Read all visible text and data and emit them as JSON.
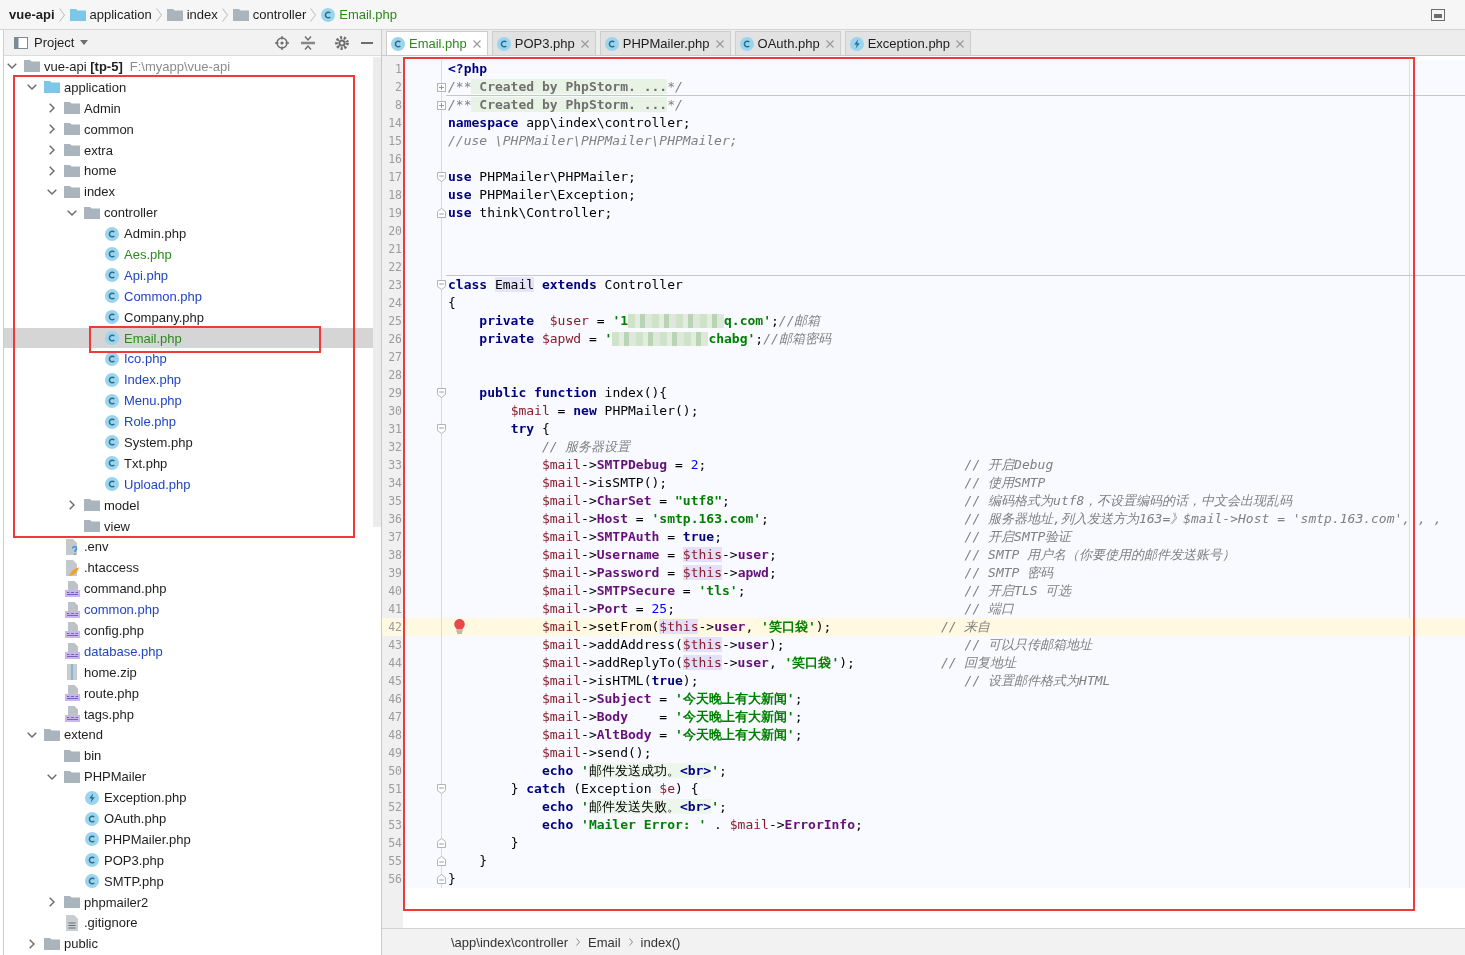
{
  "nav_bar": {
    "items": [
      {
        "label": "vue-api",
        "kind": "project",
        "added": false,
        "modified": false
      },
      {
        "label": "application",
        "kind": "source_folder",
        "added": false,
        "modified": false
      },
      {
        "label": "index",
        "kind": "folder",
        "added": false,
        "modified": false
      },
      {
        "label": "controller",
        "kind": "folder",
        "added": false,
        "modified": false
      },
      {
        "label": "Email.php",
        "kind": "class",
        "added": true,
        "modified": false
      }
    ]
  },
  "project_panel": {
    "title": "Project",
    "tree": [
      {
        "label": "vue-api **[tp-5]**",
        "path": "F:\\myapp\\vue-api",
        "kind": "folder",
        "expanded": true,
        "selected": false,
        "added": false,
        "modified": false,
        "children": [
          {
            "label": "application",
            "kind": "source_folder",
            "expanded": true,
            "selected": false,
            "added": false,
            "modified": false,
            "children": [
              {
                "label": "Admin",
                "kind": "folder",
                "expanded": false,
                "selected": false,
                "added": false,
                "modified": false
              },
              {
                "label": "common",
                "kind": "folder",
                "expanded": false,
                "selected": false,
                "added": false,
                "modified": false
              },
              {
                "label": "extra",
                "kind": "folder",
                "expanded": false,
                "selected": false,
                "added": false,
                "modified": false
              },
              {
                "label": "home",
                "kind": "folder",
                "expanded": false,
                "selected": false,
                "added": false,
                "modified": false
              },
              {
                "label": "index",
                "kind": "folder",
                "expanded": true,
                "selected": false,
                "added": false,
                "modified": false,
                "children": [
                  {
                    "label": "controller",
                    "kind": "folder",
                    "expanded": true,
                    "selected": false,
                    "added": false,
                    "modified": false,
                    "children": [
                      {
                        "label": "Admin.php",
                        "kind": "class",
                        "selected": false,
                        "added": false,
                        "modified": false
                      },
                      {
                        "label": "Aes.php",
                        "kind": "class",
                        "selected": false,
                        "added": true,
                        "modified": false
                      },
                      {
                        "label": "Api.php",
                        "kind": "class",
                        "selected": false,
                        "added": false,
                        "modified": true
                      },
                      {
                        "label": "Common.php",
                        "kind": "class",
                        "selected": false,
                        "added": false,
                        "modified": true
                      },
                      {
                        "label": "Company.php",
                        "kind": "class",
                        "selected": false,
                        "added": false,
                        "modified": false
                      },
                      {
                        "label": "Email.php",
                        "kind": "class",
                        "selected": true,
                        "added": true,
                        "modified": false
                      },
                      {
                        "label": "Ico.php",
                        "kind": "class",
                        "selected": false,
                        "added": false,
                        "modified": true
                      },
                      {
                        "label": "Index.php",
                        "kind": "class",
                        "selected": false,
                        "added": false,
                        "modified": true
                      },
                      {
                        "label": "Menu.php",
                        "kind": "class",
                        "selected": false,
                        "added": false,
                        "modified": true
                      },
                      {
                        "label": "Role.php",
                        "kind": "class",
                        "selected": false,
                        "added": false,
                        "modified": true
                      },
                      {
                        "label": "System.php",
                        "kind": "class",
                        "selected": false,
                        "added": false,
                        "modified": false
                      },
                      {
                        "label": "Txt.php",
                        "kind": "class",
                        "selected": false,
                        "added": false,
                        "modified": false
                      },
                      {
                        "label": "Upload.php",
                        "kind": "class",
                        "selected": false,
                        "added": false,
                        "modified": true
                      }
                    ]
                  },
                  {
                    "label": "model",
                    "kind": "folder",
                    "expanded": false,
                    "selected": false,
                    "added": false,
                    "modified": false
                  },
                  {
                    "label": "view",
                    "kind": "folder",
                    "selected": false,
                    "added": false,
                    "modified": false
                  }
                ]
              },
              {
                "label": ".env",
                "kind": "env",
                "selected": false,
                "added": false,
                "modified": false
              },
              {
                "label": ".htaccess",
                "kind": "htaccess",
                "selected": false,
                "added": false,
                "modified": false
              },
              {
                "label": "command.php",
                "kind": "php",
                "selected": false,
                "added": false,
                "modified": false
              },
              {
                "label": "common.php",
                "kind": "php",
                "selected": false,
                "added": false,
                "modified": true
              },
              {
                "label": "config.php",
                "kind": "php",
                "selected": false,
                "added": false,
                "modified": false
              },
              {
                "label": "database.php",
                "kind": "php",
                "selected": false,
                "added": false,
                "modified": true
              },
              {
                "label": "home.zip",
                "kind": "zip",
                "selected": false,
                "added": false,
                "modified": false
              },
              {
                "label": "route.php",
                "kind": "php",
                "selected": false,
                "added": false,
                "modified": false
              },
              {
                "label": "tags.php",
                "kind": "php",
                "selected": false,
                "added": false,
                "modified": false
              }
            ]
          },
          {
            "label": "extend",
            "kind": "folder",
            "expanded": true,
            "selected": false,
            "added": false,
            "modified": false,
            "children": [
              {
                "label": "bin",
                "kind": "folder",
                "selected": false,
                "added": false,
                "modified": false
              },
              {
                "label": "PHPMailer",
                "kind": "folder",
                "expanded": true,
                "selected": false,
                "added": false,
                "modified": false,
                "children": [
                  {
                    "label": "Exception.php",
                    "kind": "exception_class",
                    "selected": false,
                    "added": false,
                    "modified": false
                  },
                  {
                    "label": "OAuth.php",
                    "kind": "class",
                    "selected": false,
                    "added": false,
                    "modified": false
                  },
                  {
                    "label": "PHPMailer.php",
                    "kind": "class",
                    "selected": false,
                    "added": false,
                    "modified": false
                  },
                  {
                    "label": "POP3.php",
                    "kind": "class",
                    "selected": false,
                    "added": false,
                    "modified": false
                  },
                  {
                    "label": "SMTP.php",
                    "kind": "class",
                    "selected": false,
                    "added": false,
                    "modified": false
                  }
                ]
              },
              {
                "label": "phpmailer2",
                "kind": "folder",
                "expanded": false,
                "selected": false,
                "added": false,
                "modified": false
              },
              {
                "label": ".gitignore",
                "kind": "text",
                "selected": false,
                "added": false,
                "modified": false
              }
            ]
          },
          {
            "label": "public",
            "kind": "folder",
            "expanded": false,
            "selected": false,
            "added": false,
            "modified": false
          }
        ]
      }
    ]
  },
  "editor": {
    "tabs": [
      {
        "label": "Email.php",
        "kind": "class",
        "selected": true,
        "added": true,
        "modified": false
      },
      {
        "label": "POP3.php",
        "kind": "class",
        "selected": false,
        "added": false,
        "modified": false
      },
      {
        "label": "PHPMailer.php",
        "kind": "class",
        "selected": false,
        "added": false,
        "modified": false
      },
      {
        "label": "OAuth.php",
        "kind": "class",
        "selected": false,
        "added": false,
        "modified": false
      },
      {
        "label": "Exception.php",
        "kind": "exception_class",
        "selected": false,
        "added": false,
        "modified": false
      }
    ],
    "lines": [
      {
        "number": "1",
        "tokens": [
          {
            "kind": "kw",
            "text": "<?php"
          }
        ]
      },
      {
        "number": "2",
        "markers": [
          {
            "kind": "folded"
          },
          {
            "kind": "separator"
          }
        ],
        "tokens": [
          {
            "kind": "cmt",
            "text": "/**"
          },
          {
            "kind": "fold",
            "text": " Created by PhpStorm. ..."
          },
          {
            "kind": "cmt",
            "text": "*/"
          }
        ]
      },
      {
        "number": "8",
        "markers": [
          {
            "kind": "folded"
          }
        ],
        "tokens": [
          {
            "kind": "cmt",
            "text": "/**"
          },
          {
            "kind": "fold",
            "text": " Created by PhpStorm. ..."
          },
          {
            "kind": "cmt",
            "text": "*/"
          }
        ]
      },
      {
        "number": "14",
        "tokens": [
          {
            "kind": "kw",
            "text": "namespace"
          },
          {
            "kind": "plain",
            "text": " app\\index\\controller;"
          }
        ]
      },
      {
        "number": "15",
        "tokens": [
          {
            "kind": "cmt",
            "text": "//use \\PHPMailer\\PHPMailer\\PHPMailer;"
          }
        ]
      },
      {
        "number": "16"
      },
      {
        "number": "17",
        "markers": [
          {
            "kind": "fold_start"
          }
        ],
        "tokens": [
          {
            "kind": "kw",
            "text": "use"
          },
          {
            "kind": "plain",
            "text": " PHPMailer\\PHPMailer;"
          }
        ]
      },
      {
        "number": "18",
        "tokens": [
          {
            "kind": "kw",
            "text": "use"
          },
          {
            "kind": "plain",
            "text": " PHPMailer\\Exception;"
          }
        ]
      },
      {
        "number": "19",
        "markers": [
          {
            "kind": "fold_end"
          }
        ],
        "tokens": [
          {
            "kind": "kw",
            "text": "use"
          },
          {
            "kind": "plain",
            "text": " think\\Controller;"
          }
        ]
      },
      {
        "number": "20"
      },
      {
        "number": "21"
      },
      {
        "number": "22",
        "markers": [
          {
            "kind": "separator"
          }
        ]
      },
      {
        "number": "23",
        "markers": [
          {
            "kind": "fold_start"
          }
        ],
        "tokens": [
          {
            "kind": "kw",
            "text": "class "
          },
          {
            "kind": "hl",
            "text": "Email"
          },
          {
            "kind": "kw",
            "text": " extends"
          },
          {
            "kind": "plain",
            "text": " Controller"
          }
        ]
      },
      {
        "number": "24",
        "tokens": [
          {
            "kind": "plain",
            "text": "{"
          }
        ]
      },
      {
        "number": "25",
        "tokens": [
          {
            "kind": "kw",
            "text": "    private"
          },
          {
            "kind": "var",
            "text": "  $user"
          },
          {
            "kind": "plain",
            "text": " = "
          },
          {
            "kind": "str",
            "text": "'1"
          },
          {
            "kind": "redacted"
          },
          {
            "kind": "str",
            "text": "q.com'"
          },
          {
            "kind": "plain",
            "text": ";"
          },
          {
            "kind": "cmt",
            "text": "//邮箱"
          }
        ]
      },
      {
        "number": "26",
        "tokens": [
          {
            "kind": "kw",
            "text": "    private"
          },
          {
            "kind": "var",
            "text": " $apwd"
          },
          {
            "kind": "plain",
            "text": " = "
          },
          {
            "kind": "str",
            "text": "'"
          },
          {
            "kind": "redacted"
          },
          {
            "kind": "str",
            "text": "chabg'"
          },
          {
            "kind": "plain",
            "text": ";"
          },
          {
            "kind": "cmt",
            "text": "//邮箱密码"
          }
        ]
      },
      {
        "number": "27"
      },
      {
        "number": "28"
      },
      {
        "number": "29",
        "markers": [
          {
            "kind": "fold_start"
          }
        ],
        "tokens": [
          {
            "kind": "kw",
            "text": "    public"
          },
          {
            "kind": "kw",
            "text": " function"
          },
          {
            "kind": "plain",
            "text": " index(){"
          }
        ]
      },
      {
        "number": "30",
        "tokens": [
          {
            "kind": "var",
            "text": "        $mail"
          },
          {
            "kind": "plain",
            "text": " = "
          },
          {
            "kind": "kw",
            "text": "new"
          },
          {
            "kind": "plain",
            "text": " PHPMailer();"
          }
        ]
      },
      {
        "number": "31",
        "markers": [
          {
            "kind": "fold_start"
          }
        ],
        "tokens": [
          {
            "kind": "kw",
            "text": "        try"
          },
          {
            "kind": "plain",
            "text": " {"
          }
        ]
      },
      {
        "number": "32",
        "tokens": [
          {
            "kind": "cmt",
            "text": "            // 服务器设置"
          }
        ]
      },
      {
        "number": "33",
        "tokens": [
          {
            "kind": "var",
            "text": "            $mail"
          },
          {
            "kind": "plain",
            "text": "->"
          },
          {
            "kind": "fld",
            "text": "SMTPDebug"
          },
          {
            "kind": "plain",
            "text": " = "
          },
          {
            "kind": "num",
            "text": "2"
          },
          {
            "kind": "plain",
            "text": ";"
          },
          {
            "kind": "cmt",
            "text": "                                 // 开启Debug"
          }
        ]
      },
      {
        "number": "34",
        "tokens": [
          {
            "kind": "var",
            "text": "            $mail"
          },
          {
            "kind": "plain",
            "text": "->isSMTP();"
          },
          {
            "kind": "cmt",
            "text": "                                      // 使用SMTP"
          }
        ]
      },
      {
        "number": "35",
        "tokens": [
          {
            "kind": "var",
            "text": "            $mail"
          },
          {
            "kind": "plain",
            "text": "->"
          },
          {
            "kind": "fld",
            "text": "CharSet"
          },
          {
            "kind": "plain",
            "text": " = "
          },
          {
            "kind": "str",
            "text": "\"utf8\""
          },
          {
            "kind": "plain",
            "text": ";"
          },
          {
            "kind": "cmt",
            "text": "                              // 编码格式为utf8，不设置编码的话，中文会出现乱码"
          }
        ]
      },
      {
        "number": "36",
        "tokens": [
          {
            "kind": "var",
            "text": "            $mail"
          },
          {
            "kind": "plain",
            "text": "->"
          },
          {
            "kind": "fld",
            "text": "Host"
          },
          {
            "kind": "plain",
            "text": " = "
          },
          {
            "kind": "str",
            "text": "'smtp.163.com'"
          },
          {
            "kind": "plain",
            "text": ";"
          },
          {
            "kind": "cmt",
            "text": "                         // 服务器地址,列入发送方为163=》$mail->Host = 'smtp.163.com', , ,"
          }
        ]
      },
      {
        "number": "37",
        "tokens": [
          {
            "kind": "var",
            "text": "            $mail"
          },
          {
            "kind": "plain",
            "text": "->"
          },
          {
            "kind": "fld",
            "text": "SMTPAuth"
          },
          {
            "kind": "plain",
            "text": " = "
          },
          {
            "kind": "kw",
            "text": "true"
          },
          {
            "kind": "plain",
            "text": ";"
          },
          {
            "kind": "cmt",
            "text": "                               // 开启SMTP验证"
          }
        ]
      },
      {
        "number": "38",
        "tokens": [
          {
            "kind": "var",
            "text": "            $mail"
          },
          {
            "kind": "plain",
            "text": "->"
          },
          {
            "kind": "fld",
            "text": "Username"
          },
          {
            "kind": "plain",
            "text": " = "
          },
          {
            "kind": "hlvar",
            "text": "$this"
          },
          {
            "kind": "plain",
            "text": "->"
          },
          {
            "kind": "fld",
            "text": "user"
          },
          {
            "kind": "plain",
            "text": ";"
          },
          {
            "kind": "cmt",
            "text": "                        // SMTP 用户名（你要使用的邮件发送账号）"
          }
        ]
      },
      {
        "number": "39",
        "tokens": [
          {
            "kind": "var",
            "text": "            $mail"
          },
          {
            "kind": "plain",
            "text": "->"
          },
          {
            "kind": "fld",
            "text": "Password"
          },
          {
            "kind": "plain",
            "text": " = "
          },
          {
            "kind": "hlvar",
            "text": "$this"
          },
          {
            "kind": "plain",
            "text": "->"
          },
          {
            "kind": "fld",
            "text": "apwd"
          },
          {
            "kind": "plain",
            "text": ";"
          },
          {
            "kind": "cmt",
            "text": "                        // SMTP 密码"
          }
        ]
      },
      {
        "number": "40",
        "tokens": [
          {
            "kind": "var",
            "text": "            $mail"
          },
          {
            "kind": "plain",
            "text": "->"
          },
          {
            "kind": "fld",
            "text": "SMTPSecure"
          },
          {
            "kind": "plain",
            "text": " = "
          },
          {
            "kind": "str",
            "text": "'tls'"
          },
          {
            "kind": "plain",
            "text": ";"
          },
          {
            "kind": "cmt",
            "text": "                            // 开启TLS 可选"
          }
        ]
      },
      {
        "number": "41",
        "tokens": [
          {
            "kind": "var",
            "text": "            $mail"
          },
          {
            "kind": "plain",
            "text": "->"
          },
          {
            "kind": "fld",
            "text": "Port"
          },
          {
            "kind": "plain",
            "text": " = "
          },
          {
            "kind": "num",
            "text": "25"
          },
          {
            "kind": "plain",
            "text": ";"
          },
          {
            "kind": "cmt",
            "text": "                                     // 端口"
          }
        ]
      },
      {
        "number": "42",
        "markers": [
          {
            "kind": "current_line"
          },
          {
            "kind": "bulb"
          }
        ],
        "tokens": [
          {
            "kind": "var",
            "text": "            $mail"
          },
          {
            "kind": "plain",
            "text": "->setFrom("
          },
          {
            "kind": "hlvar",
            "text": "$this"
          },
          {
            "kind": "plain",
            "text": "->"
          },
          {
            "kind": "fld",
            "text": "user"
          },
          {
            "kind": "plain",
            "text": ", "
          },
          {
            "kind": "str",
            "text": "'笑口袋'"
          },
          {
            "kind": "plain",
            "text": ");"
          },
          {
            "kind": "cmt",
            "text": "              // 来自"
          }
        ]
      },
      {
        "number": "43",
        "tokens": [
          {
            "kind": "var",
            "text": "            $mail"
          },
          {
            "kind": "plain",
            "text": "->addAddress("
          },
          {
            "kind": "hlvar",
            "text": "$this"
          },
          {
            "kind": "plain",
            "text": "->"
          },
          {
            "kind": "fld",
            "text": "user"
          },
          {
            "kind": "plain",
            "text": ");"
          },
          {
            "kind": "cmt",
            "text": "                       // 可以只传邮箱地址"
          }
        ]
      },
      {
        "number": "44",
        "tokens": [
          {
            "kind": "var",
            "text": "            $mail"
          },
          {
            "kind": "plain",
            "text": "->addReplyTo("
          },
          {
            "kind": "hlvar",
            "text": "$this"
          },
          {
            "kind": "plain",
            "text": "->"
          },
          {
            "kind": "fld",
            "text": "user"
          },
          {
            "kind": "plain",
            "text": ", "
          },
          {
            "kind": "str",
            "text": "'笑口袋'"
          },
          {
            "kind": "plain",
            "text": ");"
          },
          {
            "kind": "cmt",
            "text": "           // 回复地址"
          }
        ]
      },
      {
        "number": "45",
        "tokens": [
          {
            "kind": "var",
            "text": "            $mail"
          },
          {
            "kind": "plain",
            "text": "->isHTML("
          },
          {
            "kind": "kw",
            "text": "true"
          },
          {
            "kind": "plain",
            "text": ");"
          },
          {
            "kind": "cmt",
            "text": "                                  // 设置邮件格式为HTML"
          }
        ]
      },
      {
        "number": "46",
        "tokens": [
          {
            "kind": "var",
            "text": "            $mail"
          },
          {
            "kind": "plain",
            "text": "->"
          },
          {
            "kind": "fld",
            "text": "Subject"
          },
          {
            "kind": "plain",
            "text": " = "
          },
          {
            "kind": "str",
            "text": "'今天晚上有大新闻'"
          },
          {
            "kind": "plain",
            "text": ";"
          }
        ]
      },
      {
        "number": "47",
        "tokens": [
          {
            "kind": "var",
            "text": "            $mail"
          },
          {
            "kind": "plain",
            "text": "->"
          },
          {
            "kind": "fld",
            "text": "Body"
          },
          {
            "kind": "plain",
            "text": "    = "
          },
          {
            "kind": "str",
            "text": "'今天晚上有大新闻'"
          },
          {
            "kind": "plain",
            "text": ";"
          }
        ]
      },
      {
        "number": "48",
        "tokens": [
          {
            "kind": "var",
            "text": "            $mail"
          },
          {
            "kind": "plain",
            "text": "->"
          },
          {
            "kind": "fld",
            "text": "AltBody"
          },
          {
            "kind": "plain",
            "text": " = "
          },
          {
            "kind": "str",
            "text": "'今天晚上有大新闻'"
          },
          {
            "kind": "plain",
            "text": ";"
          }
        ]
      },
      {
        "number": "49",
        "tokens": [
          {
            "kind": "var",
            "text": "            $mail"
          },
          {
            "kind": "plain",
            "text": "->send();"
          }
        ]
      },
      {
        "number": "50",
        "tokens": [
          {
            "kind": "kw",
            "text": "            echo"
          },
          {
            "kind": "str",
            "text": " '"
          },
          {
            "kind": "inj",
            "text": "邮件发送成功。"
          },
          {
            "kind": "injtag",
            "text": "<br>"
          },
          {
            "kind": "str",
            "text": "'"
          },
          {
            "kind": "plain",
            "text": ";"
          }
        ]
      },
      {
        "number": "51",
        "markers": [
          {
            "kind": "fold_start"
          }
        ],
        "tokens": [
          {
            "kind": "plain",
            "text": "        } "
          },
          {
            "kind": "kw",
            "text": "catch"
          },
          {
            "kind": "plain",
            "text": " (Exception "
          },
          {
            "kind": "var",
            "text": "$e"
          },
          {
            "kind": "plain",
            "text": ") {"
          }
        ]
      },
      {
        "number": "52",
        "tokens": [
          {
            "kind": "kw",
            "text": "            echo"
          },
          {
            "kind": "str",
            "text": " '"
          },
          {
            "kind": "inj",
            "text": "邮件发送失败。"
          },
          {
            "kind": "injtag",
            "text": "<br>"
          },
          {
            "kind": "str",
            "text": "'"
          },
          {
            "kind": "plain",
            "text": ";"
          }
        ]
      },
      {
        "number": "53",
        "tokens": [
          {
            "kind": "kw",
            "text": "            echo"
          },
          {
            "kind": "str",
            "text": " 'Mailer Error: '"
          },
          {
            "kind": "plain",
            "text": " . "
          },
          {
            "kind": "var",
            "text": "$mail"
          },
          {
            "kind": "plain",
            "text": "->"
          },
          {
            "kind": "fld",
            "text": "ErrorInfo"
          },
          {
            "kind": "plain",
            "text": ";"
          }
        ]
      },
      {
        "number": "54",
        "markers": [
          {
            "kind": "fold_end"
          }
        ],
        "tokens": [
          {
            "kind": "plain",
            "text": "        }"
          }
        ]
      },
      {
        "number": "55",
        "markers": [
          {
            "kind": "fold_end"
          }
        ],
        "tokens": [
          {
            "kind": "plain",
            "text": "    }"
          }
        ]
      },
      {
        "number": "56",
        "markers": [
          {
            "kind": "fold_end"
          }
        ],
        "tokens": [
          {
            "kind": "plain",
            "text": "}"
          }
        ]
      }
    ],
    "breadcrumbs": [
      "\\app\\index\\controller",
      "Email",
      "index()"
    ]
  }
}
